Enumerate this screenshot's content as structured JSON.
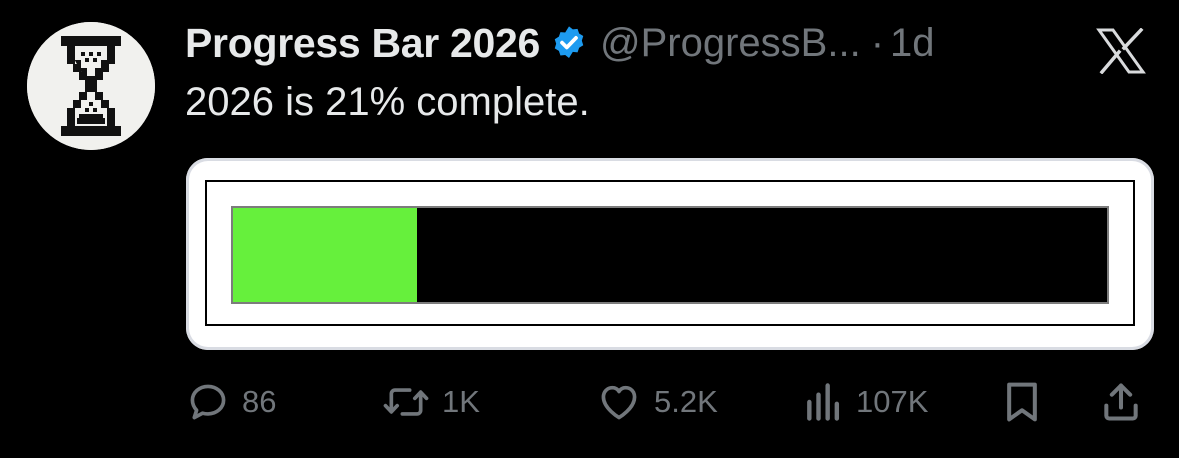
{
  "tweet": {
    "author_name": "Progress Bar 2026",
    "handle": "@ProgressB...",
    "separator": "·",
    "time": "1d",
    "text": "2026 is 21% complete.",
    "verified": true,
    "avatar_icon": "hourglass-icon",
    "platform_icon": "x-logo-icon"
  },
  "progress": {
    "percent": 21,
    "fill_color": "#66f03c"
  },
  "actions": {
    "replies": "86",
    "reposts": "1K",
    "likes": "5.2K",
    "views": "107K"
  },
  "colors": {
    "background": "#000000",
    "text": "#e7e9ea",
    "muted": "#71767b",
    "verified": "#1d9bf0"
  }
}
